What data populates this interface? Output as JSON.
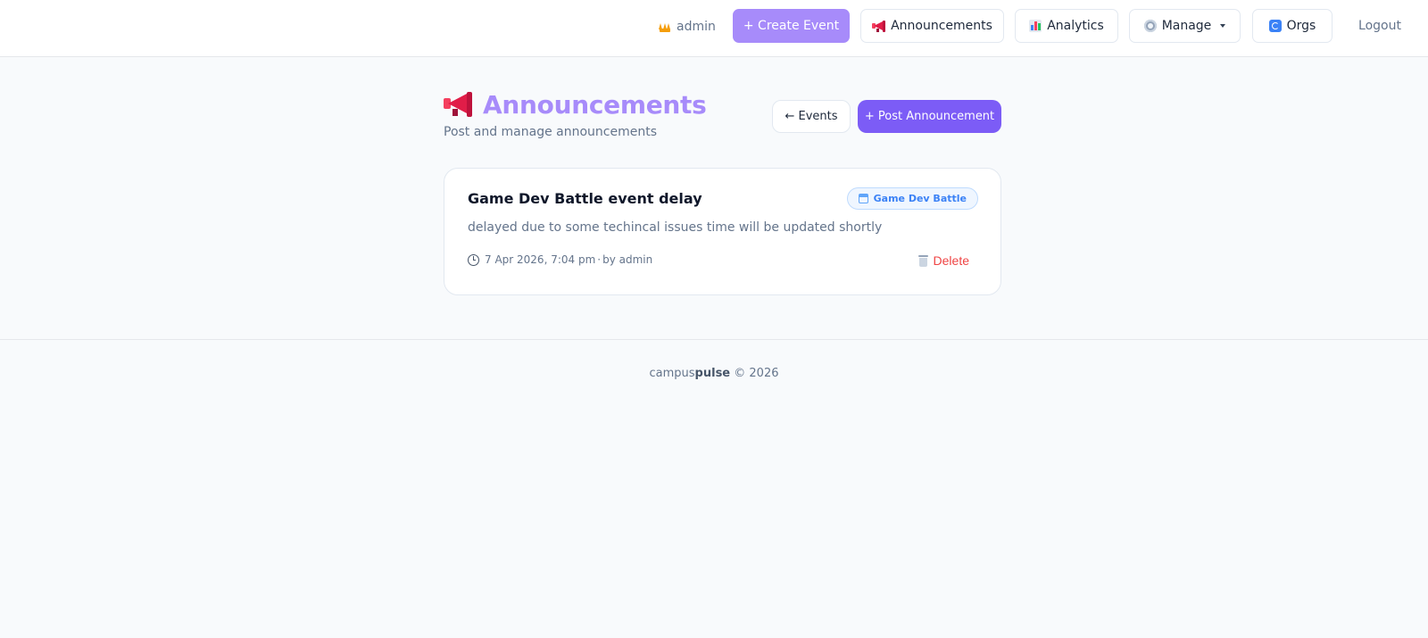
{
  "nav": {
    "user": {
      "icon": "crown-icon",
      "label": "admin"
    },
    "create_event": "+ Create Event",
    "announcements": {
      "icon": "megaphone-icon",
      "label": "Announcements"
    },
    "analytics": {
      "icon": "bar-chart-icon",
      "label": "Analytics"
    },
    "manage": {
      "icon": "gear-icon",
      "label": "Manage"
    },
    "orgs": {
      "icon": "refresh-icon",
      "label": "Orgs"
    },
    "logout": "Logout"
  },
  "page": {
    "title": "Announcements",
    "title_icon": "megaphone-icon",
    "subtitle": "Post and manage announcements",
    "back_button": "← Events",
    "post_button": "+ Post Announcement"
  },
  "announcements": [
    {
      "title": "Game Dev Battle event delay",
      "event_badge": "Game Dev Battle",
      "body": "delayed due to some techincal issues time will be updated shortly",
      "date": "7 Apr 2026, 7:04 pm",
      "separator": "·",
      "author": "by admin",
      "delete_label": "Delete"
    }
  ],
  "footer": {
    "brand_light": "campus",
    "brand_bold": "pulse",
    "copyright": "© 2026"
  },
  "colors": {
    "accent": "#a78bfa",
    "primary_button": "#7c5cf6",
    "danger": "#ef4444",
    "badge": "#3b82f6"
  }
}
